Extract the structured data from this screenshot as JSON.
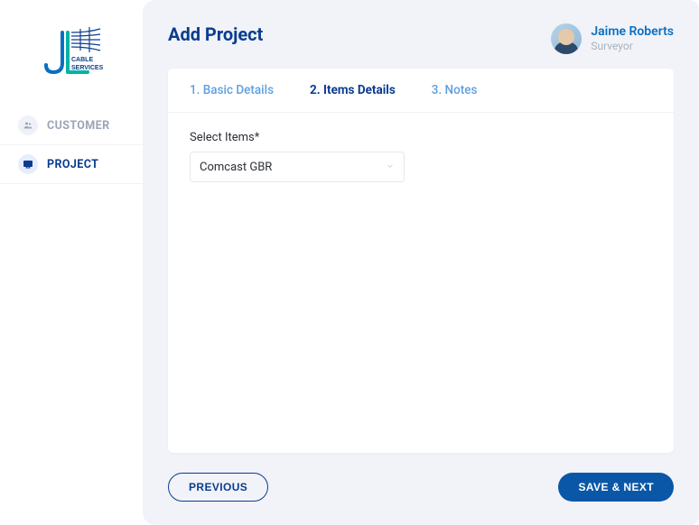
{
  "brand": {
    "line1": "CABLE",
    "line2": "SERVICES"
  },
  "sidebar": {
    "items": [
      {
        "label": "CUSTOMER",
        "icon": "users-icon",
        "active": false
      },
      {
        "label": "PROJECT",
        "icon": "project-icon",
        "active": true
      }
    ]
  },
  "header": {
    "title": "Add Project",
    "user": {
      "name": "Jaime Roberts",
      "role": "Surveyor"
    }
  },
  "tabs": [
    {
      "label": "1. Basic Details",
      "active": false
    },
    {
      "label": "2. Items Details",
      "active": true
    },
    {
      "label": "3. Notes",
      "active": false
    }
  ],
  "form": {
    "select_items_label": "Select Items*",
    "select_items_value": "Comcast GBR"
  },
  "footer": {
    "previous": "PREVIOUS",
    "save_next": "SAVE & NEXT"
  }
}
